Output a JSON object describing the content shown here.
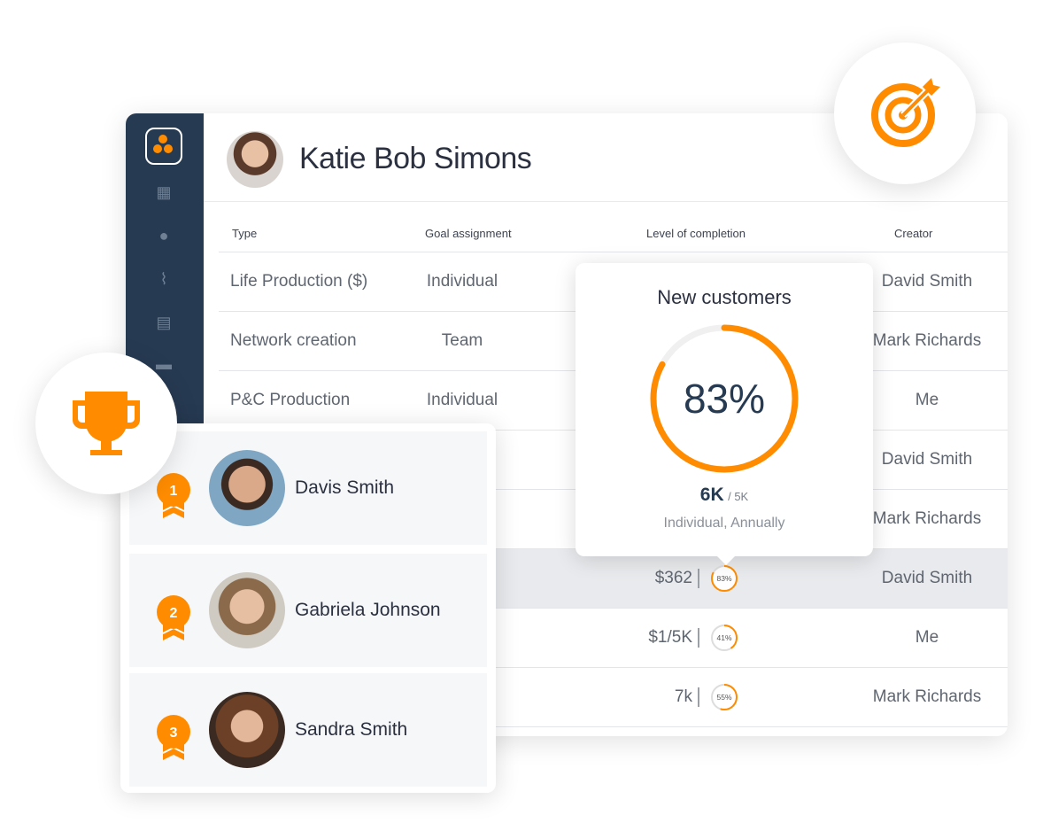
{
  "header": {
    "user_name": "Katie Bob Simons"
  },
  "sidebar": {
    "icons": [
      "building-icon",
      "user-circle-icon",
      "activity-icon",
      "calendar-icon",
      "briefcase-icon"
    ]
  },
  "table": {
    "columns": [
      "Type",
      "Goal assignment",
      "Level of completion",
      "Creator"
    ],
    "rows": [
      {
        "type": "Life Production ($)",
        "assignment": "Individual",
        "value": "",
        "percent": null,
        "creator": "David Smith"
      },
      {
        "type": "Network creation",
        "assignment": "Team",
        "value": "",
        "percent": null,
        "creator": "Mark Richards"
      },
      {
        "type": "P&C Production",
        "assignment": "Individual",
        "value": "",
        "percent": null,
        "creator": "Me"
      },
      {
        "type": "",
        "assignment": "",
        "value": "",
        "percent": null,
        "creator": "David Smith"
      },
      {
        "type": "",
        "assignment": "",
        "value": "",
        "percent": null,
        "creator": "Mark Richards"
      },
      {
        "type": "",
        "assignment": "",
        "value": "$362",
        "percent": "83%",
        "creator": "David Smith",
        "highlighted": true
      },
      {
        "type": "",
        "assignment": "",
        "value": "$1/5K",
        "percent": "41%",
        "creator": "Me"
      },
      {
        "type": "",
        "assignment": "",
        "value": "7k",
        "percent": "55%",
        "creator": "Mark Richards"
      }
    ]
  },
  "popover": {
    "title": "New customers",
    "percent_label": "83%",
    "percent": 83,
    "current": "6K",
    "target": "/ 5K",
    "subtitle": "Individual, Annually"
  },
  "leaderboard": {
    "items": [
      {
        "rank": "1",
        "name": "Davis Smith"
      },
      {
        "rank": "2",
        "name": "Gabriela Johnson"
      },
      {
        "rank": "3",
        "name": "Sandra Smith"
      }
    ]
  },
  "colors": {
    "accent": "#ff8c00",
    "sidebar": "#263a52",
    "text": "#2b3040"
  },
  "badges": {
    "trophy": "trophy-icon",
    "target": "target-icon"
  }
}
